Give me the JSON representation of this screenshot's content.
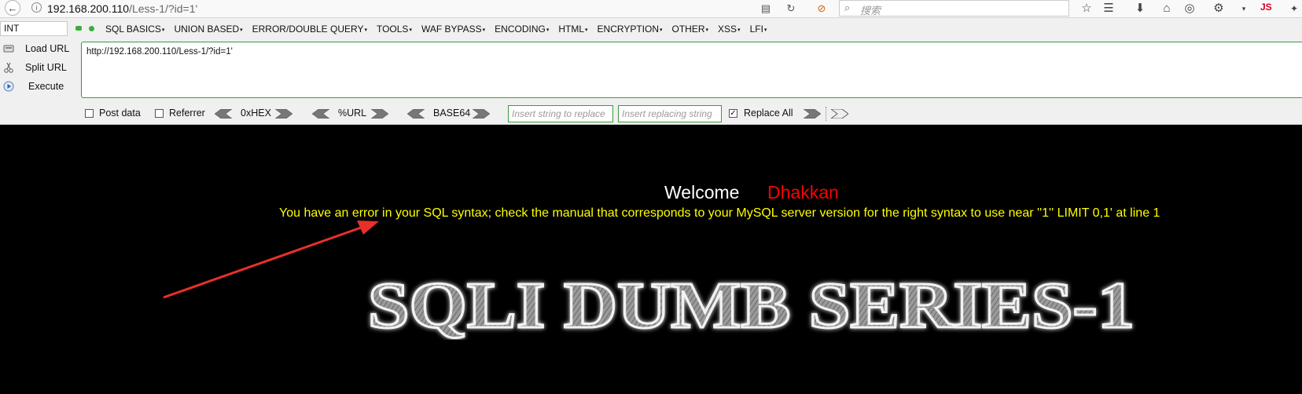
{
  "browser": {
    "url_host": "192.168.200.110",
    "url_path": "/Less-1/?id=1'",
    "search_placeholder": "搜索",
    "js_badge": "JS"
  },
  "hackbar": {
    "type_select": "INT",
    "menu": [
      "SQL BASICS",
      "UNION BASED",
      "ERROR/DOUBLE QUERY",
      "TOOLS",
      "WAF BYPASS",
      "ENCODING",
      "HTML",
      "ENCRYPTION",
      "OTHER",
      "XSS",
      "LFI"
    ],
    "load_url": "Load URL",
    "split_url": "Split URL",
    "execute": "Execute",
    "url_value": "http://192.168.200.110/Less-1/?id=1'",
    "post_data_label": "Post data",
    "referrer_label": "Referrer",
    "hex_label": "0xHEX",
    "url_enc_label": "%URL",
    "base64_label": "BASE64",
    "replace_string_placeholder": "Insert string to replace",
    "replacing_string_placeholder": "Insert replacing string",
    "replace_all_label": "Replace All",
    "post_data_checked": false,
    "referrer_checked": false,
    "replace_all_checked": true
  },
  "page": {
    "welcome": "Welcome",
    "name": "Dhakkan",
    "error_message": "You have an error in your SQL syntax; check the manual that corresponds to your MySQL server version for the right syntax to use near ''1'' LIMIT 0,1' at line 1",
    "banner": "SQLI DUMB SERIES-1"
  },
  "colors": {
    "error_text": "#ffff00",
    "name_text": "#ff0000",
    "annotation_arrow": "#e8302a",
    "hackbar_green": "#3a9b3a"
  }
}
